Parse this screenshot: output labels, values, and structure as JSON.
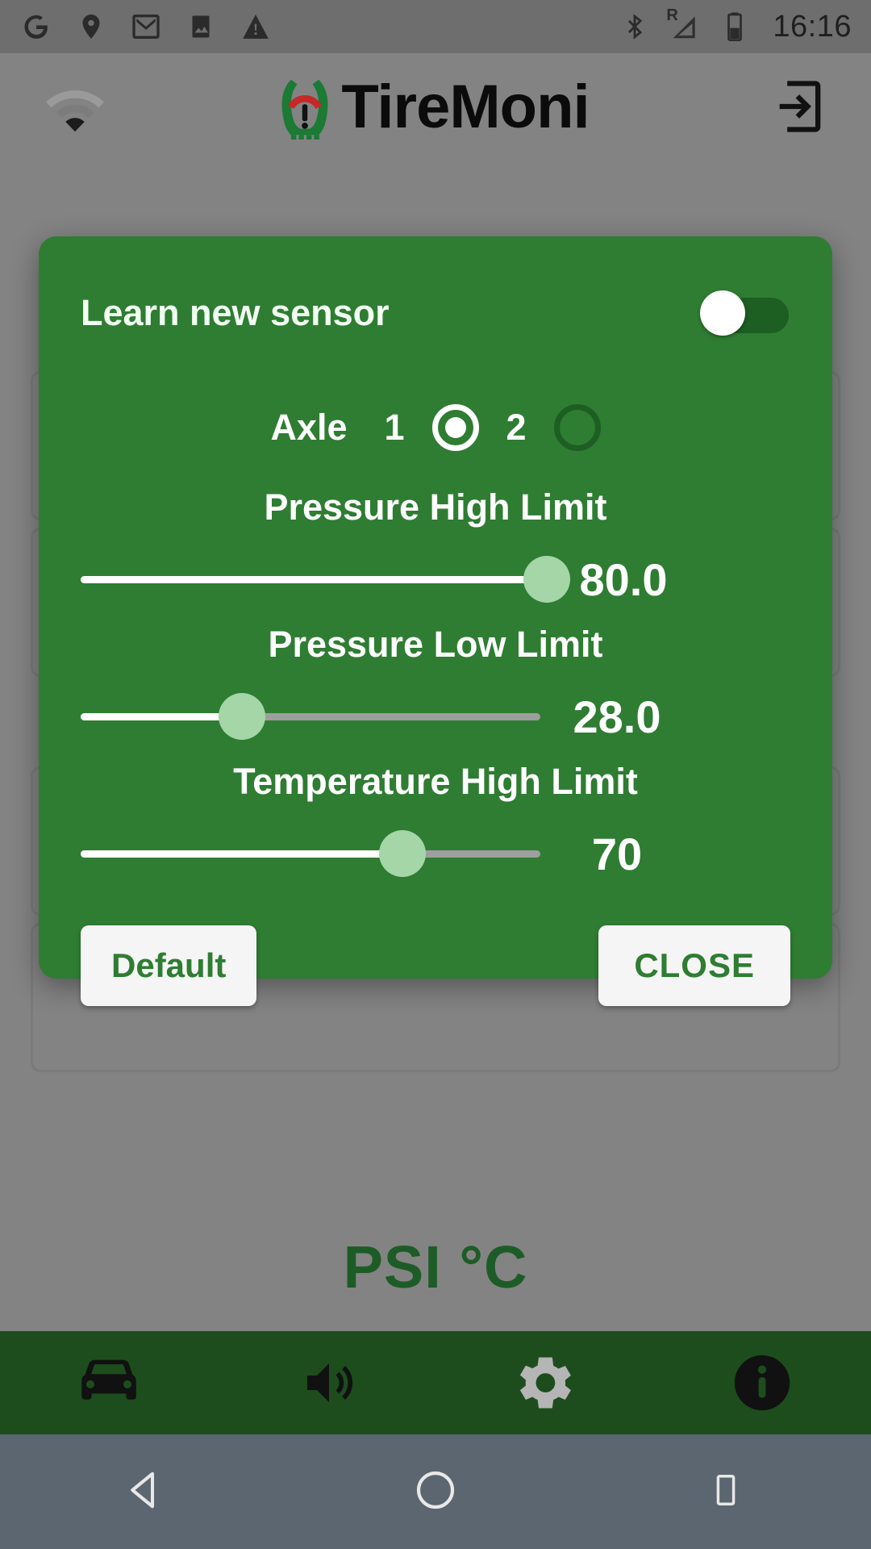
{
  "status_bar": {
    "time": "16:16",
    "left_icons": [
      "google-icon",
      "location-icon",
      "gmail-icon",
      "photos-icon",
      "warning-icon"
    ],
    "right_icons": [
      "bluetooth-icon",
      "signal-roaming-icon",
      "battery-icon"
    ],
    "signal_label": "R"
  },
  "app_header": {
    "wifi_icon": "wifi-icon",
    "title": "TireMoni",
    "logo_icon": "tiremoni-logo-icon",
    "exit_icon": "exit-to-app-icon"
  },
  "background": {
    "unit_label": "PSI °C"
  },
  "dialog": {
    "learn_sensor": {
      "label": "Learn new sensor",
      "toggle_state": "off"
    },
    "axle": {
      "label": "Axle",
      "options": [
        {
          "value": "1",
          "selected": true
        },
        {
          "value": "2",
          "selected": false
        }
      ]
    },
    "sliders": [
      {
        "title": "Pressure High Limit",
        "value": "80.0",
        "percent": 100
      },
      {
        "title": "Pressure Low Limit",
        "value": "28.0",
        "percent": 35
      },
      {
        "title": "Temperature High Limit",
        "value": "70",
        "percent": 70
      }
    ],
    "buttons": {
      "default_label": "Default",
      "close_label": "CLOSE"
    }
  },
  "tab_bar": {
    "tabs": [
      {
        "name": "car-icon",
        "active": false
      },
      {
        "name": "volume-icon",
        "active": false
      },
      {
        "name": "gear-icon",
        "active": true
      },
      {
        "name": "info-icon",
        "active": false
      }
    ]
  },
  "nav_bar": {
    "buttons": [
      "back-triangle-icon",
      "home-circle-icon",
      "recents-square-icon"
    ]
  },
  "colors": {
    "dialog_green": "#2e7d32",
    "tabbar_green": "#1d4d1d",
    "thumb_green": "#a5d6a7",
    "scrim_gray": "#838383"
  }
}
